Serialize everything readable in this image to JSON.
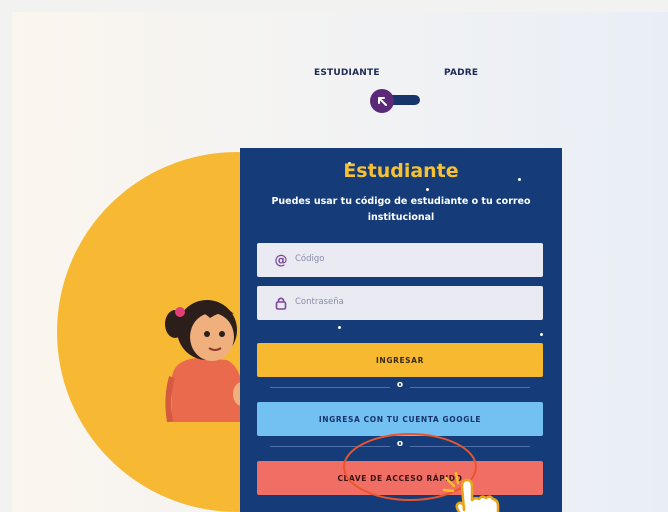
{
  "role_selector": {
    "student_label": "ESTUDIANTE",
    "parent_label": "PADRE"
  },
  "login_card": {
    "title": "Estudiante",
    "subtitle": "Puedes usar tu código de estudiante o tu correo institucional",
    "code_placeholder": "Código",
    "password_placeholder": "Contraseña",
    "login_button": "INGRESAR",
    "separator": "o",
    "google_button": "INGRESA CON TU CUENTA GOOGLE",
    "quick_access_button": "CLAVE DE ACCESO RÁPIDO"
  },
  "colors": {
    "card_bg": "#153c78",
    "title_yellow": "#f6c233",
    "login_btn": "#f7b92f",
    "google_btn": "#73c0f3",
    "quick_btn": "#f06e63",
    "highlight_ring": "#e8562e"
  },
  "icons": {
    "code_field": "at-sign-icon",
    "password_field": "padlock-icon",
    "toggle": "arrow-up-left-icon",
    "cursor": "pointing-hand-icon"
  }
}
